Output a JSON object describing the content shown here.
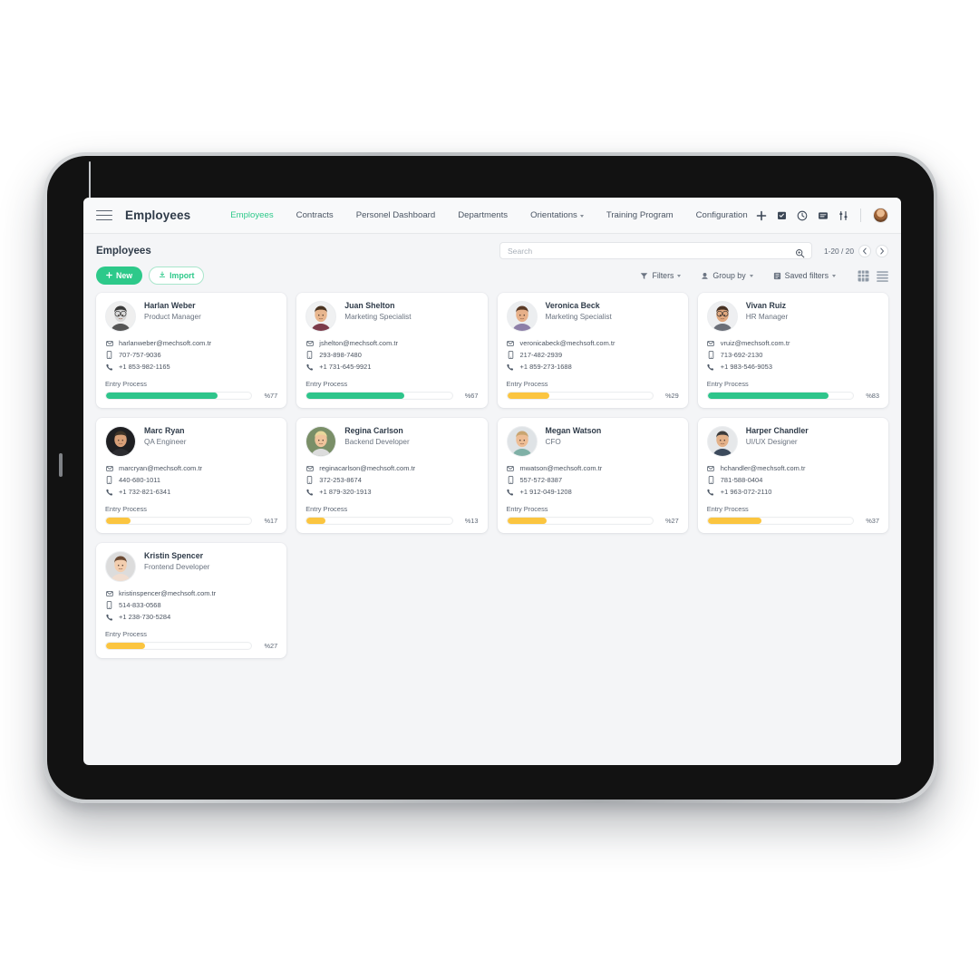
{
  "app": {
    "title": "Employees",
    "nav": [
      {
        "label": "Employees",
        "active": true,
        "caret": false
      },
      {
        "label": "Contracts",
        "active": false,
        "caret": false
      },
      {
        "label": "Personel Dashboard",
        "active": false,
        "caret": false
      },
      {
        "label": "Departments",
        "active": false,
        "caret": false
      },
      {
        "label": "Orientations",
        "active": false,
        "caret": true
      },
      {
        "label": "Training Program",
        "active": false,
        "caret": false
      },
      {
        "label": "Configuration",
        "active": false,
        "caret": false
      }
    ],
    "header_icons": [
      "plus-icon",
      "calendar-check-icon",
      "clock-icon",
      "message-icon",
      "sliders-icon"
    ],
    "avatar": "user-avatar"
  },
  "toolbar": {
    "page_title": "Employees",
    "new_label": "New",
    "import_label": "Import",
    "search_placeholder": "Search",
    "search_value": "",
    "pager_label": "1-20 / 20",
    "filters": [
      {
        "label": "Filters",
        "icon": "funnel-icon"
      },
      {
        "label": "Group by",
        "icon": "group-icon"
      },
      {
        "label": "Saved filters",
        "icon": "bookmark-icon"
      }
    ],
    "views": [
      {
        "name": "grid-view",
        "active": true
      },
      {
        "name": "list-view",
        "active": false
      }
    ]
  },
  "colors": {
    "accent_green": "#2dc98a",
    "progress_green": "#2ec58b",
    "progress_yellow": "#fbc540",
    "text_dark": "#2f3b49",
    "text_muted": "#69727f"
  },
  "cards": {
    "process_label": "Entry Process",
    "items": [
      {
        "name": "Harlan Weber",
        "role": "Product Manager",
        "email": "harlanweber@mechsoft.com.tr",
        "mobile": "707-757-9036",
        "phone": "+1 853-982-1165",
        "progress": 77,
        "progress_text": "%77",
        "bar": "green",
        "avatar": {
          "skin": "#d9d9d9",
          "hair": "#3a3a3a",
          "shirt": "#555555",
          "glasses": true,
          "bg": "#efefef"
        }
      },
      {
        "name": "Juan Shelton",
        "role": "Marketing Specialist",
        "email": "jshelton@mechsoft.com.tr",
        "mobile": "293-898-7480",
        "phone": "+1 731-645-9921",
        "progress": 67,
        "progress_text": "%67",
        "bar": "green",
        "avatar": {
          "skin": "#e8b68e",
          "hair": "#4b3422",
          "shirt": "#7b3b4a",
          "glasses": false,
          "bg": "#f0f1f2"
        }
      },
      {
        "name": "Veronica Beck",
        "role": "Marketing Specialist",
        "email": "veronicabeck@mechsoft.com.tr",
        "mobile": "217-482-2939",
        "phone": "+1 859-273-1688",
        "progress": 29,
        "progress_text": "%29",
        "bar": "yellow",
        "avatar": {
          "skin": "#e7b089",
          "hair": "#5a3a26",
          "shirt": "#8d7fa8",
          "glasses": false,
          "bg": "#eceef0"
        }
      },
      {
        "name": "Vivan Ruiz",
        "role": "HR Manager",
        "email": "vruiz@mechsoft.com.tr",
        "mobile": "713-692-2130",
        "phone": "+1 983-546-9053",
        "progress": 83,
        "progress_text": "%83",
        "bar": "green",
        "avatar": {
          "skin": "#e0a87f",
          "hair": "#463123",
          "shirt": "#6b6f78",
          "glasses": true,
          "bg": "#eeeff1"
        }
      },
      {
        "name": "Marc Ryan",
        "role": "QA Engineer",
        "email": "marcryan@mechsoft.com.tr",
        "mobile": "440-680-1011",
        "phone": "+1 732-821-6341",
        "progress": 17,
        "progress_text": "%17",
        "bar": "yellow",
        "avatar": {
          "skin": "#d8a079",
          "hair": "#3f3428",
          "shirt": "#2c2c30",
          "glasses": false,
          "bg": "#1f1f22"
        }
      },
      {
        "name": "Regina Carlson",
        "role": "Backend Developer",
        "email": "reginacarlson@mechsoft.com.tr",
        "mobile": "372-253-8674",
        "phone": "+1 879-320-1913",
        "progress": 13,
        "progress_text": "%13",
        "bar": "yellow",
        "avatar": {
          "skin": "#f0c49c",
          "hair": "#e8d79a",
          "shirt": "#dcdcdc",
          "glasses": false,
          "bg": "#7a8f68"
        }
      },
      {
        "name": "Megan Watson",
        "role": "CFO",
        "email": "mwatson@mechsoft.com.tr",
        "mobile": "557-572-8387",
        "phone": "+1 912-049-1208",
        "progress": 27,
        "progress_text": "%27",
        "bar": "yellow",
        "avatar": {
          "skin": "#edbd95",
          "hair": "#c9a571",
          "shirt": "#7fb0a6",
          "glasses": false,
          "bg": "#dfe3e6"
        }
      },
      {
        "name": "Harper Chandler",
        "role": "UI/UX Designer",
        "email": "hchandler@mechsoft.com.tr",
        "mobile": "781-588-0404",
        "phone": "+1 963-072-2110",
        "progress": 37,
        "progress_text": "%37",
        "bar": "yellow",
        "avatar": {
          "skin": "#e3b189",
          "hair": "#3b3b3b",
          "shirt": "#3c4a5c",
          "glasses": false,
          "bg": "#e6e8ea"
        }
      },
      {
        "name": "Kristin Spencer",
        "role": "Frontend Developer",
        "email": "kristinspencer@mechsoft.com.tr",
        "mobile": "514-833-0568",
        "phone": "+1 238-730-5284",
        "progress": 27,
        "progress_text": "%27",
        "bar": "yellow",
        "avatar": {
          "skin": "#f2cdae",
          "hair": "#6b4a33",
          "shirt": "#f0ddd0",
          "glasses": false,
          "bg": "#dcdcdc"
        }
      }
    ]
  }
}
